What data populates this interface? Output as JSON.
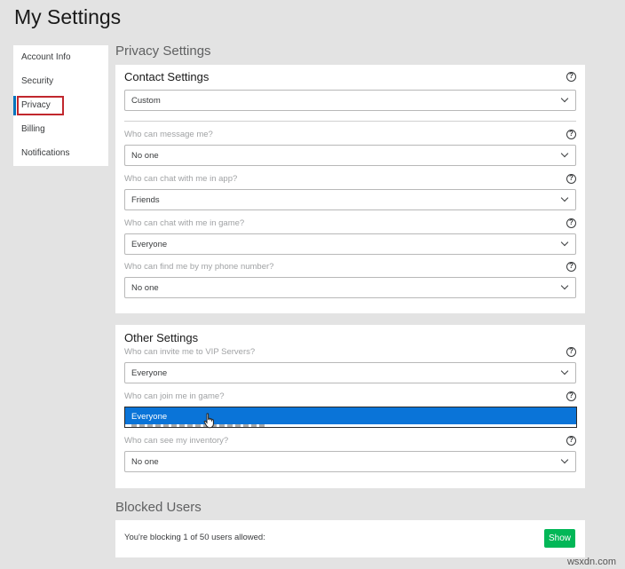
{
  "page": {
    "title": "My Settings"
  },
  "nav": {
    "items": [
      {
        "label": "Account Info"
      },
      {
        "label": "Security"
      },
      {
        "label": "Privacy"
      },
      {
        "label": "Billing"
      },
      {
        "label": "Notifications"
      }
    ],
    "active": "Privacy"
  },
  "privacy": {
    "heading": "Privacy Settings",
    "contact": {
      "title": "Contact Settings",
      "preset_value": "Custom",
      "fields": [
        {
          "label": "Who can message me?",
          "value": "No one"
        },
        {
          "label": "Who can chat with me in app?",
          "value": "Friends"
        },
        {
          "label": "Who can chat with me in game?",
          "value": "Everyone"
        },
        {
          "label": "Who can find me by my phone number?",
          "value": "No one"
        }
      ]
    },
    "other": {
      "title": "Other Settings",
      "fields": [
        {
          "label": "Who can invite me to VIP Servers?",
          "value": "Everyone"
        },
        {
          "label": "Who can join me in game?",
          "value": "Everyone"
        },
        {
          "label": "Who can see my inventory?",
          "value": "No one"
        }
      ],
      "open_dropdown_highlighted": "Everyone"
    }
  },
  "blocked": {
    "heading": "Blocked Users",
    "text": "You're blocking 1 of 50 users allowed:",
    "button_label": "Show"
  },
  "icons": {
    "help": "?"
  },
  "colors": {
    "accent": "#0074bd",
    "highlight_border": "#c1272d",
    "show_button": "#02b757",
    "dropdown_selected": "#0a74d8"
  },
  "watermark": "wsxdn.com"
}
